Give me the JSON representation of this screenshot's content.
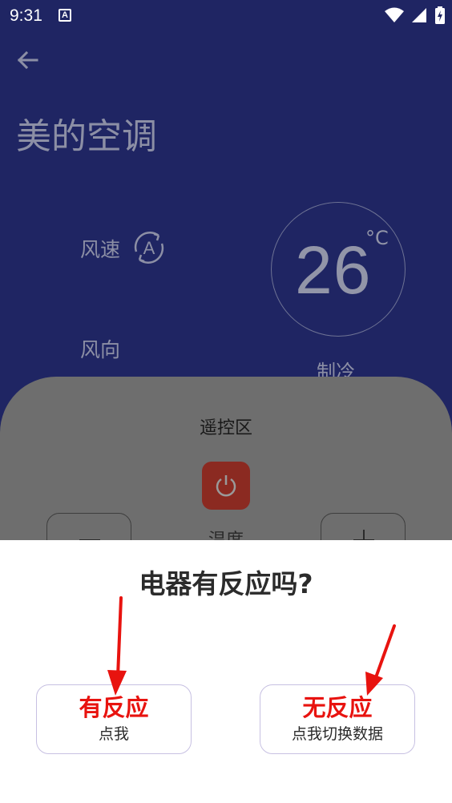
{
  "status_bar": {
    "time": "9:31",
    "notification_icon_letter": "A",
    "icons": [
      "wifi-icon",
      "signal-icon",
      "battery-charging-icon"
    ]
  },
  "header": {
    "title": "美的空调",
    "back_icon": "arrow-left-icon"
  },
  "ac_panel": {
    "wind_speed_label": "风速",
    "wind_speed_mode_icon": "auto-cycle-icon",
    "wind_speed_mode_letter": "A",
    "wind_direction_label": "风向",
    "temperature": "26",
    "temperature_unit": "°C",
    "mode": "制冷"
  },
  "remote": {
    "title": "遥控区",
    "power_icon": "power-icon",
    "temp_label": "温度"
  },
  "dialog": {
    "title": "电器有反应吗?",
    "yes": {
      "main": "有反应",
      "sub": "点我"
    },
    "no": {
      "main": "无反应",
      "sub": "点我切换数据"
    }
  },
  "colors": {
    "app_background": "#1f2563",
    "overlay_panel": "#6e6e6e",
    "power_button": "#8b2a21",
    "accent_red": "#e8130f",
    "button_border": "#c7c0e2"
  }
}
